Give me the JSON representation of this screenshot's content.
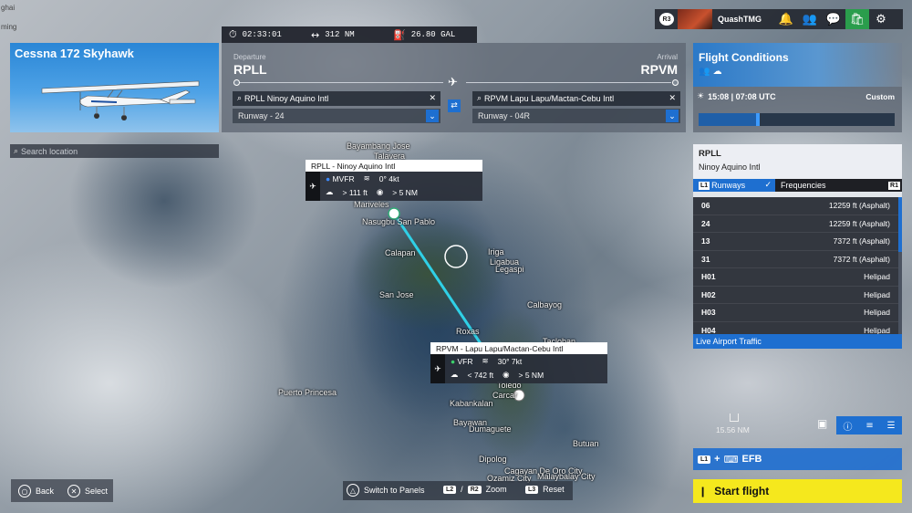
{
  "map": {
    "edge_labels": [
      "ghai",
      "ming"
    ],
    "labels": [
      {
        "text": "Bayambang Jose",
        "cls": "l1"
      },
      {
        "text": "Talavera",
        "cls": "l2"
      },
      {
        "text": "Mariveles",
        "cls": "l3"
      },
      {
        "text": "Nasugbu San Pablo",
        "cls": "l4"
      },
      {
        "text": "Calapan",
        "cls": "l5"
      },
      {
        "text": "Iriga",
        "cls": "l6"
      },
      {
        "text": "Ligabua",
        "cls": "l7"
      },
      {
        "text": "Legaspi",
        "cls": "l8"
      },
      {
        "text": "San Jose",
        "cls": "l9"
      },
      {
        "text": "Calbayog",
        "cls": "l10"
      },
      {
        "text": "Roxas",
        "cls": "l11"
      },
      {
        "text": "Tacloban",
        "cls": "l12"
      },
      {
        "text": "Puerto Princesa",
        "cls": "l13"
      },
      {
        "text": "Kabankalan",
        "cls": "l14"
      },
      {
        "text": "Carcar",
        "cls": "l15"
      },
      {
        "text": "Toledo",
        "cls": "l16"
      },
      {
        "text": "Bayawan",
        "cls": "l17"
      },
      {
        "text": "Dumaguete",
        "cls": "l18"
      },
      {
        "text": "Butuan",
        "cls": "l19"
      },
      {
        "text": "Dipolog",
        "cls": "l20"
      },
      {
        "text": "Cagayan De Oro City",
        "cls": "l21"
      },
      {
        "text": "Ozamiz City",
        "cls": "l22"
      },
      {
        "text": "Malaybalay City",
        "cls": "l23"
      }
    ],
    "scale": "15.56 NM"
  },
  "aircraft": {
    "name": "Cessna 172 Skyhawk"
  },
  "search": {
    "placeholder": "Search location"
  },
  "stats": {
    "time": "02:33:01",
    "distance": "312 NM",
    "fuel": "26.80 GAL"
  },
  "departure": {
    "label": "Departure",
    "icao": "RPLL",
    "airport": "RPLL Ninoy Aquino Intl",
    "runway": "Runway - 24"
  },
  "arrival": {
    "label": "Arrival",
    "icao": "RPVM",
    "airport": "RPVM Lapu Lapu/Mactan-Cebu Intl",
    "runway": "Runway - 04R"
  },
  "user": {
    "badge": "R3",
    "name": "QuashTMG"
  },
  "conditions": {
    "title": "Flight Conditions",
    "time": "15:08 | 07:08 UTC",
    "mode": "Custom",
    "time_of_day_fraction": 0.3
  },
  "airport_panel": {
    "icao": "RPLL",
    "name": "Ninoy Aquino Intl",
    "tabs": {
      "left_badge": "L1",
      "runways": "Runways",
      "frequencies": "Frequencies",
      "right_badge": "R1"
    },
    "runways": [
      {
        "id": "06",
        "info": "12259 ft (Asphalt)"
      },
      {
        "id": "24",
        "info": "12259 ft (Asphalt)"
      },
      {
        "id": "13",
        "info": "7372 ft (Asphalt)"
      },
      {
        "id": "31",
        "info": "7372 ft (Asphalt)"
      },
      {
        "id": "H01",
        "info": "Helipad"
      },
      {
        "id": "H02",
        "info": "Helipad"
      },
      {
        "id": "H03",
        "info": "Helipad"
      },
      {
        "id": "H04",
        "info": "Helipad"
      }
    ],
    "live_traffic": "Live Airport Traffic"
  },
  "dep_card": {
    "title": "RPLL - Ninoy Aquino Intl",
    "category": "MVFR",
    "wind": "0° 4kt",
    "ceiling": "> 111 ft",
    "visibility": "> 5 NM"
  },
  "arr_card": {
    "title": "RPVM - Lapu Lapu/Mactan-Cebu Intl",
    "category": "VFR",
    "wind": "30° 7kt",
    "ceiling": "< 742 ft",
    "visibility": "> 5 NM"
  },
  "controls": {
    "back": "Back",
    "select": "Select",
    "switch_panels": "Switch to Panels",
    "l2": "L2",
    "r2": "R2",
    "zoom": "Zoom",
    "l3": "L3",
    "reset": "Reset",
    "efb_badge": "L1",
    "efb": "EFB",
    "start_flight": "Start flight"
  },
  "colors": {
    "accent": "#1e6fd0",
    "start": "#f5e81d",
    "route": "#2fd0e6",
    "store": "#2a9d4c"
  }
}
